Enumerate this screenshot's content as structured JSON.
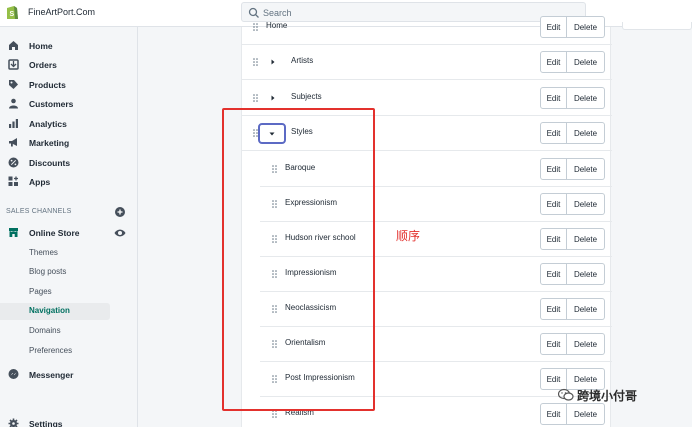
{
  "topbar": {
    "store_name": "FineArtPort.Com",
    "search_placeholder": "Search"
  },
  "sidebar": {
    "items": [
      {
        "label": "Home",
        "icon": "home-icon"
      },
      {
        "label": "Orders",
        "icon": "orders-icon"
      },
      {
        "label": "Products",
        "icon": "tag-icon"
      },
      {
        "label": "Customers",
        "icon": "person-icon"
      },
      {
        "label": "Analytics",
        "icon": "bar-chart-icon"
      },
      {
        "label": "Marketing",
        "icon": "megaphone-icon"
      },
      {
        "label": "Discounts",
        "icon": "discount-icon"
      },
      {
        "label": "Apps",
        "icon": "apps-icon"
      }
    ],
    "sales_channels_heading": "SALES CHANNELS",
    "online_store": "Online Store",
    "online_store_sub": [
      "Themes",
      "Blog posts",
      "Pages",
      "Navigation",
      "Domains",
      "Preferences"
    ],
    "active_sub": "Navigation",
    "messenger": "Messenger",
    "settings": "Settings"
  },
  "menu": {
    "top_items": [
      {
        "label": "Home"
      },
      {
        "label": "Artists"
      },
      {
        "label": "Subjects"
      },
      {
        "label": "Styles"
      }
    ],
    "styles_children": [
      "Baroque",
      "Expressionism",
      "Hudson river school",
      "Impressionism",
      "Neoclassicism",
      "Orientalism",
      "Post Impressionism",
      "Realism"
    ],
    "edit_label": "Edit",
    "delete_label": "Delete"
  },
  "annotation": {
    "text": "顺序",
    "color": "#e3312d"
  },
  "watermark": {
    "text": "跨境小付哥"
  },
  "colors": {
    "accent": "#5c6ac4",
    "active_nav": "#007060",
    "shopify_green": "#95bf47"
  }
}
